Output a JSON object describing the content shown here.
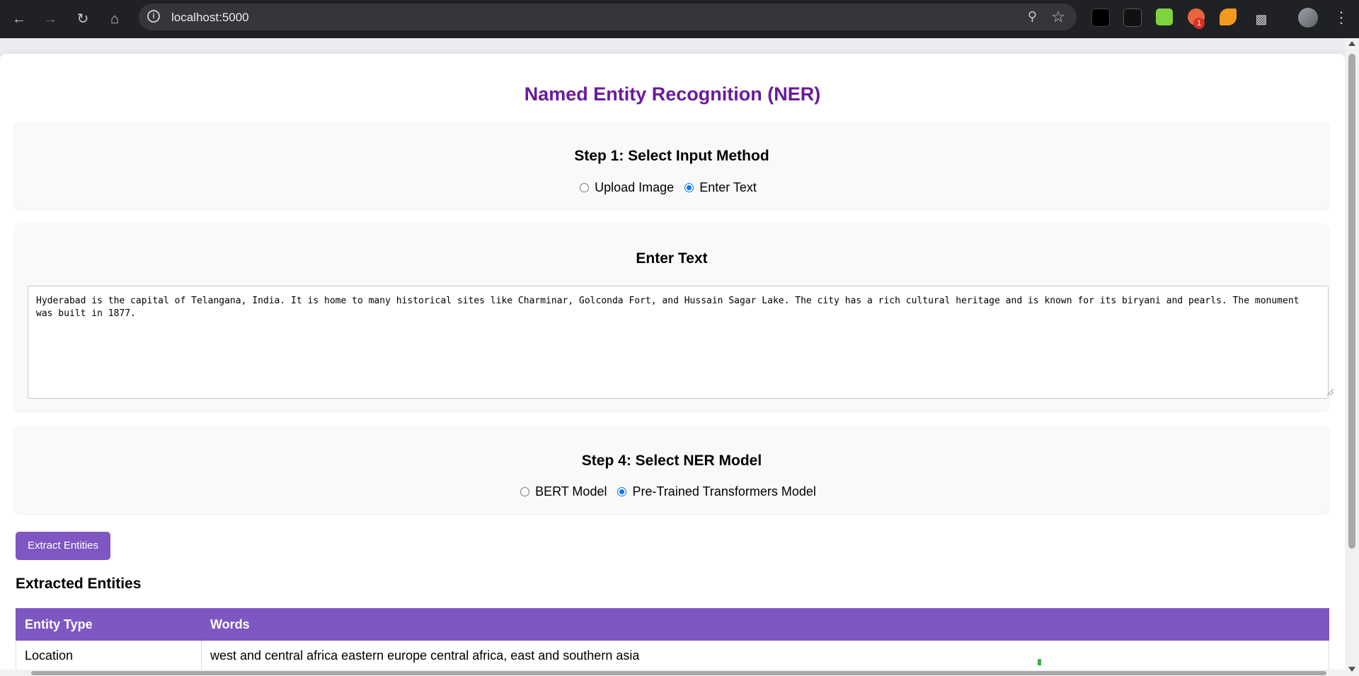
{
  "browser": {
    "url": "localhost:5000",
    "extension_badge": "1"
  },
  "page": {
    "title": "Named Entity Recognition (NER)",
    "step1": {
      "title": "Step 1: Select Input Method",
      "options": [
        "Upload Image",
        "Enter Text"
      ],
      "selected": "Enter Text"
    },
    "enter_text": {
      "title": "Enter Text",
      "value": "Hyderabad is the capital of Telangana, India. It is home to many historical sites like Charminar, Golconda Fort, and Hussain Sagar Lake. The city has a rich cultural heritage and is known for its biryani and pearls. The monument was built in 1877."
    },
    "step4": {
      "title": "Step 4: Select NER Model",
      "options": [
        "BERT Model",
        "Pre-Trained Transformers Model"
      ],
      "selected": "Pre-Trained Transformers Model"
    },
    "extract_button": "Extract Entities",
    "results": {
      "title": "Extracted Entities",
      "headers": [
        "Entity Type",
        "Words"
      ],
      "rows": [
        [
          "Location",
          "west and central africa eastern europe central africa, east and southern asia"
        ]
      ]
    }
  },
  "colors": {
    "title": "#6a1b9a",
    "accent": "#7e57c2",
    "radio_checked": "#0075ff"
  }
}
